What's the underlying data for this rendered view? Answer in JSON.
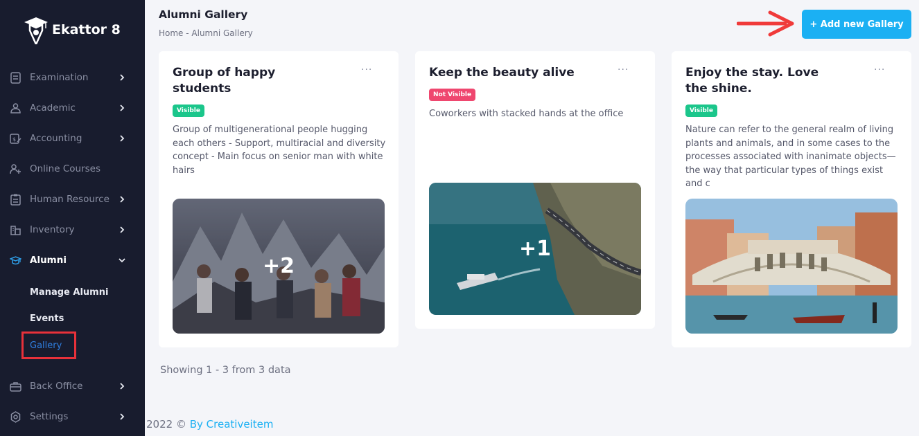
{
  "app": {
    "name": "Ekattor 8"
  },
  "sidebar": {
    "items": [
      {
        "label": "Examination",
        "icon": "exam-icon",
        "chevron": true
      },
      {
        "label": "Academic",
        "icon": "academic-icon",
        "chevron": true
      },
      {
        "label": "Accounting",
        "icon": "accounting-icon",
        "chevron": true
      },
      {
        "label": "Online Courses",
        "icon": "online-courses-icon",
        "chevron": false
      },
      {
        "label": "Human Resource",
        "icon": "human-resource-icon",
        "chevron": true
      },
      {
        "label": "Inventory",
        "icon": "inventory-icon",
        "chevron": true
      },
      {
        "label": "Alumni",
        "icon": "alumni-icon",
        "chevron": true,
        "expanded": true
      },
      {
        "label": "Back Office",
        "icon": "back-office-icon",
        "chevron": true
      },
      {
        "label": "Settings",
        "icon": "settings-icon",
        "chevron": true
      }
    ],
    "alumni_sub": [
      "Manage Alumni",
      "Events",
      "Gallery"
    ],
    "active_sub": "Gallery"
  },
  "header": {
    "title": "Alumni Gallery",
    "breadcrumb_home": "Home",
    "breadcrumb_sep": " - ",
    "breadcrumb_current": "Alumni Gallery",
    "add_button": "+ Add new Gallery"
  },
  "cards": [
    {
      "title_line1": "Group of happy",
      "title_line2": "students",
      "status": "Visible",
      "description": "Group of multigenerational people hugging each others - Support, multiracial and diversity concept - Main focus on senior man with white hairs",
      "extra_count": "+2",
      "menu": "..."
    },
    {
      "title_line1": "Keep the beauty alive",
      "title_line2": "",
      "status": "Not Visible",
      "description": "Coworkers with stacked hands at the office",
      "extra_count": "+1",
      "menu": "..."
    },
    {
      "title_line1": "Enjoy the stay. Love",
      "title_line2": "the shine.",
      "status": "Visible",
      "description": "Nature can refer to the general realm of living plants and animals, and in some cases to the processes associated with inanimate objects—the way that particular types of things exist and c",
      "extra_count": "",
      "menu": "..."
    }
  ],
  "pagination": {
    "text": "Showing 1 - 3 from 3 data"
  },
  "footer": {
    "text": "2022 ©",
    "link": "By Creativeitem"
  },
  "colors": {
    "sidebar": "#181c2e",
    "accent": "#1bb0f3",
    "visible": "#1bc68b",
    "not_visible": "#ef476f",
    "highlight": "#e8313a"
  }
}
